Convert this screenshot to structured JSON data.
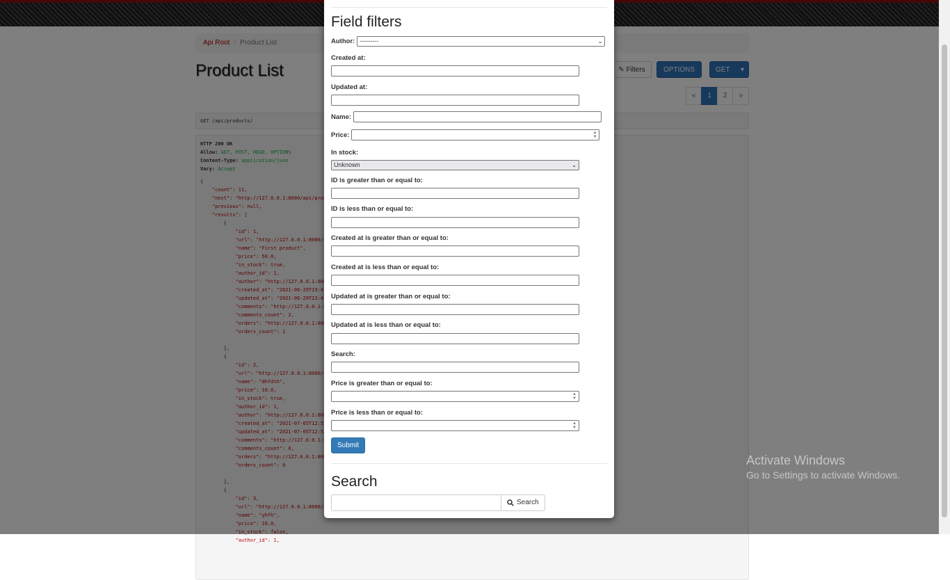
{
  "breadcrumb": {
    "root": "Api Root",
    "current": "Product List"
  },
  "page": {
    "title": "Product List"
  },
  "toolbar": {
    "filters_label": "Filters",
    "options_label": "OPTIONS",
    "get_label": "GET"
  },
  "pagination": {
    "prev": "«",
    "pages": [
      "1",
      "2"
    ],
    "next": "»",
    "current": "1"
  },
  "request": {
    "line": "GET  /api/products/"
  },
  "response": {
    "headers": [
      {
        "name": "HTTP 200 OK",
        "value": ""
      },
      {
        "name": "Allow:",
        "value": "GET, POST, HEAD, OPTIONS"
      },
      {
        "name": "Content-Type:",
        "value": "application/json"
      },
      {
        "name": "Vary:",
        "value": "Accept"
      }
    ],
    "body_lines": [
      "{",
      "    \"count\": 11,",
      "    \"next\": \"http://127.0.0.1:8000/api/produ",
      "    \"previous\": null,",
      "    \"results\": [",
      "        {",
      "            \"id\": 1,",
      "            \"url\": \"http://127.0.0.1:8000/api",
      "            \"name\": \"First product\",",
      "            \"price\": 50.0,",
      "            \"in_stock\": true,",
      "            \"author_id\": 1,",
      "            \"author\": \"http://127.0.0.1:8000",
      "            \"created_at\": \"2021-06-29T23:43",
      "            \"updated_at\": \"2021-06-29T23:43",
      "            \"comments\": \"http://127.0.0.1:80",
      "            \"comments_count\": 2,",
      "            \"orders\": \"http://127.0.0.1:8000",
      "            \"orders_count\": 1",
      "",
      "        },",
      "        {",
      "            \"id\": 2,",
      "            \"url\": \"http://127.0.0.1:8000/api",
      "            \"name\": \"dhfdth\",",
      "            \"price\": 10.0,",
      "            \"in_stock\": true,",
      "            \"author_id\": 1,",
      "            \"author\": \"http://127.0.0.1:8000",
      "            \"created_at\": \"2021-07-05T12:52",
      "            \"updated_at\": \"2021-07-05T12:52",
      "            \"comments\": \"http://127.0.0.1:80",
      "            \"comments_count\": 0,",
      "            \"orders\": \"http://127.0.0.1:8000",
      "            \"orders_count\": 0",
      "",
      "        },",
      "        {",
      "            \"id\": 3,",
      "            \"url\": \"http://127.0.0.1:8000/api",
      "            \"name\": \"yhfh\",",
      "            \"price\": 10.0,",
      "            \"in_stock\": false,",
      "            \"author_id\": 1,"
    ]
  },
  "modal": {
    "field_filters_title": "Field filters",
    "author_label": "Author:",
    "author_value": "---------",
    "created_at_label": "Created at:",
    "updated_at_label": "Updated at:",
    "name_label": "Name:",
    "price_label": "Price:",
    "in_stock_label": "In stock:",
    "in_stock_value": "Unknown",
    "id_gte_label": "ID is greater than or equal to:",
    "id_lte_label": "ID is less than or equal to:",
    "created_gte_label": "Created at is greater than or equal to:",
    "created_lte_label": "Created at is less than or equal to:",
    "updated_gte_label": "Updated at is greater than or equal to:",
    "updated_lte_label": "Updated at is less than or equal to:",
    "search_field_label": "Search:",
    "price_gte_label": "Price is greater than or equal to:",
    "price_lte_label": "Price is less than or equal to:",
    "submit_label": "Submit",
    "search_title": "Search",
    "search_button_label": "Search"
  },
  "watermark": {
    "line1": "Activate Windows",
    "line2": "Go to Settings to activate Windows."
  },
  "colors": {
    "primary": "#337ab7",
    "link": "#c20000",
    "overlay": "rgba(0,0,0,0.5)"
  },
  "icons": {
    "search": "search-icon",
    "filter": "wrench-icon"
  }
}
